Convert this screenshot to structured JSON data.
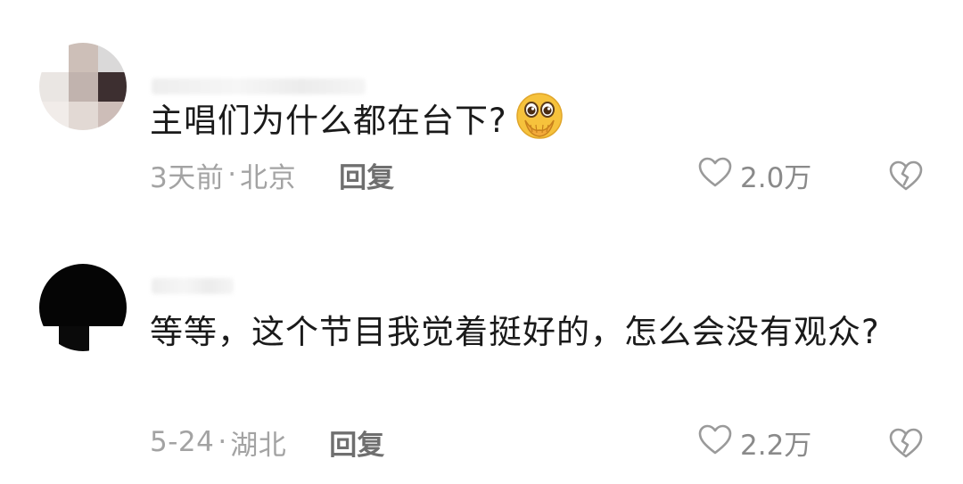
{
  "comments": [
    {
      "text": "主唱们为什么都在台下?",
      "emoji_icon": "pleading-face-hands-over-mouth-emoji",
      "time": "3天前",
      "separator": "·",
      "location": "北京",
      "reply_label": "回复",
      "like_icon": "heart-outline-icon",
      "like_count": "2.0万",
      "dislike_icon": "broken-heart-outline-icon"
    },
    {
      "text": "等等，这个节目我觉着挺好的，怎么会没有观众?",
      "time": "5-24",
      "separator": "·",
      "location": "湖北",
      "reply_label": "回复",
      "like_icon": "heart-outline-icon",
      "like_count": "2.2万",
      "dislike_icon": "broken-heart-outline-icon"
    }
  ],
  "colors": {
    "text_primary": "#1a1a1a",
    "text_meta": "#a3a3a3",
    "reply": "#6f6f6f",
    "icon": "#9a9a9a",
    "emoji_face": "#f6c23c"
  }
}
